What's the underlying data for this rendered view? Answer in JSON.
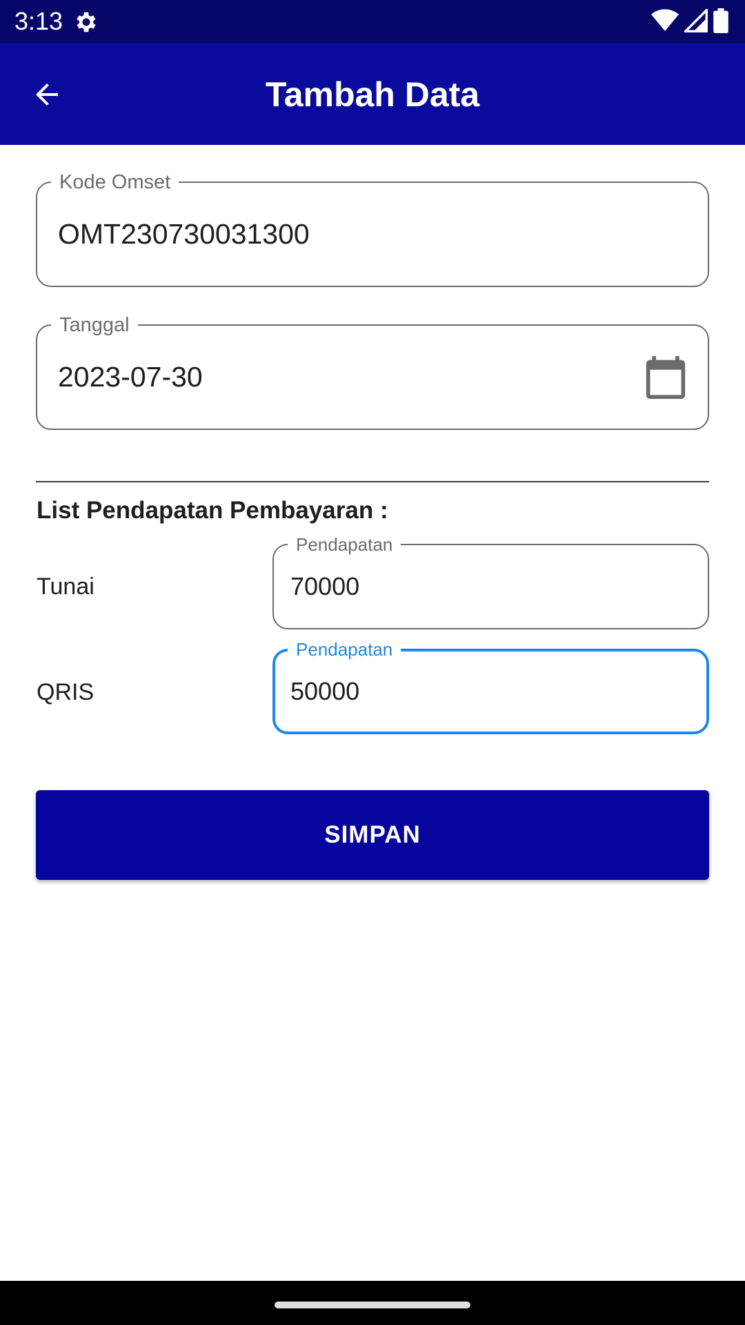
{
  "status_bar": {
    "time": "3:13"
  },
  "app_bar": {
    "title": "Tambah Data"
  },
  "form": {
    "kode_omset": {
      "label": "Kode Omset",
      "value": "OMT230730031300"
    },
    "tanggal": {
      "label": "Tanggal",
      "value": "2023-07-30"
    }
  },
  "section": {
    "title": "List Pendapatan Pembayaran :"
  },
  "payments": [
    {
      "method": "Tunai",
      "field_label": "Pendapatan",
      "value": "70000"
    },
    {
      "method": "QRIS",
      "field_label": "Pendapatan",
      "value": "50000"
    }
  ],
  "save_button": {
    "label": "SIMPAN"
  },
  "colors": {
    "status_bar": "#07076a",
    "app_bar": "#0a0a9c",
    "button": "#06069e",
    "focus": "#1e88e5"
  }
}
